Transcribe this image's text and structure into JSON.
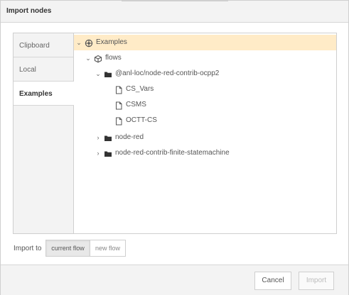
{
  "dialog": {
    "title": "Import nodes"
  },
  "sidebar": {
    "tabs": [
      {
        "label": "Clipboard",
        "active": false
      },
      {
        "label": "Local",
        "active": false
      },
      {
        "label": "Examples",
        "active": true
      }
    ]
  },
  "tree": {
    "items": [
      {
        "label": "Examples",
        "icon": "globe-icon",
        "expanded": true,
        "selected": true
      },
      {
        "label": "flows",
        "icon": "cube-icon",
        "expanded": true
      },
      {
        "label": "@anl-loc/node-red-contrib-ocpp2",
        "icon": "folder-icon",
        "expanded": true
      },
      {
        "label": "CS_Vars",
        "icon": "file-icon"
      },
      {
        "label": "CSMS",
        "icon": "file-icon"
      },
      {
        "label": "OCTT-CS",
        "icon": "file-icon"
      },
      {
        "label": "node-red",
        "icon": "folder-icon",
        "expanded": false
      },
      {
        "label": "node-red-contrib-finite-statemachine",
        "icon": "folder-icon",
        "expanded": false
      }
    ]
  },
  "import_to": {
    "label": "Import to",
    "options": [
      {
        "label": "current flow",
        "selected": true
      },
      {
        "label": "new flow",
        "selected": false
      }
    ]
  },
  "buttons": {
    "cancel": "Cancel",
    "import": "Import"
  },
  "colors": {
    "selected_row": "#ffebc7",
    "panel_background": "#f3f3f3",
    "border": "#cfcfcf"
  }
}
